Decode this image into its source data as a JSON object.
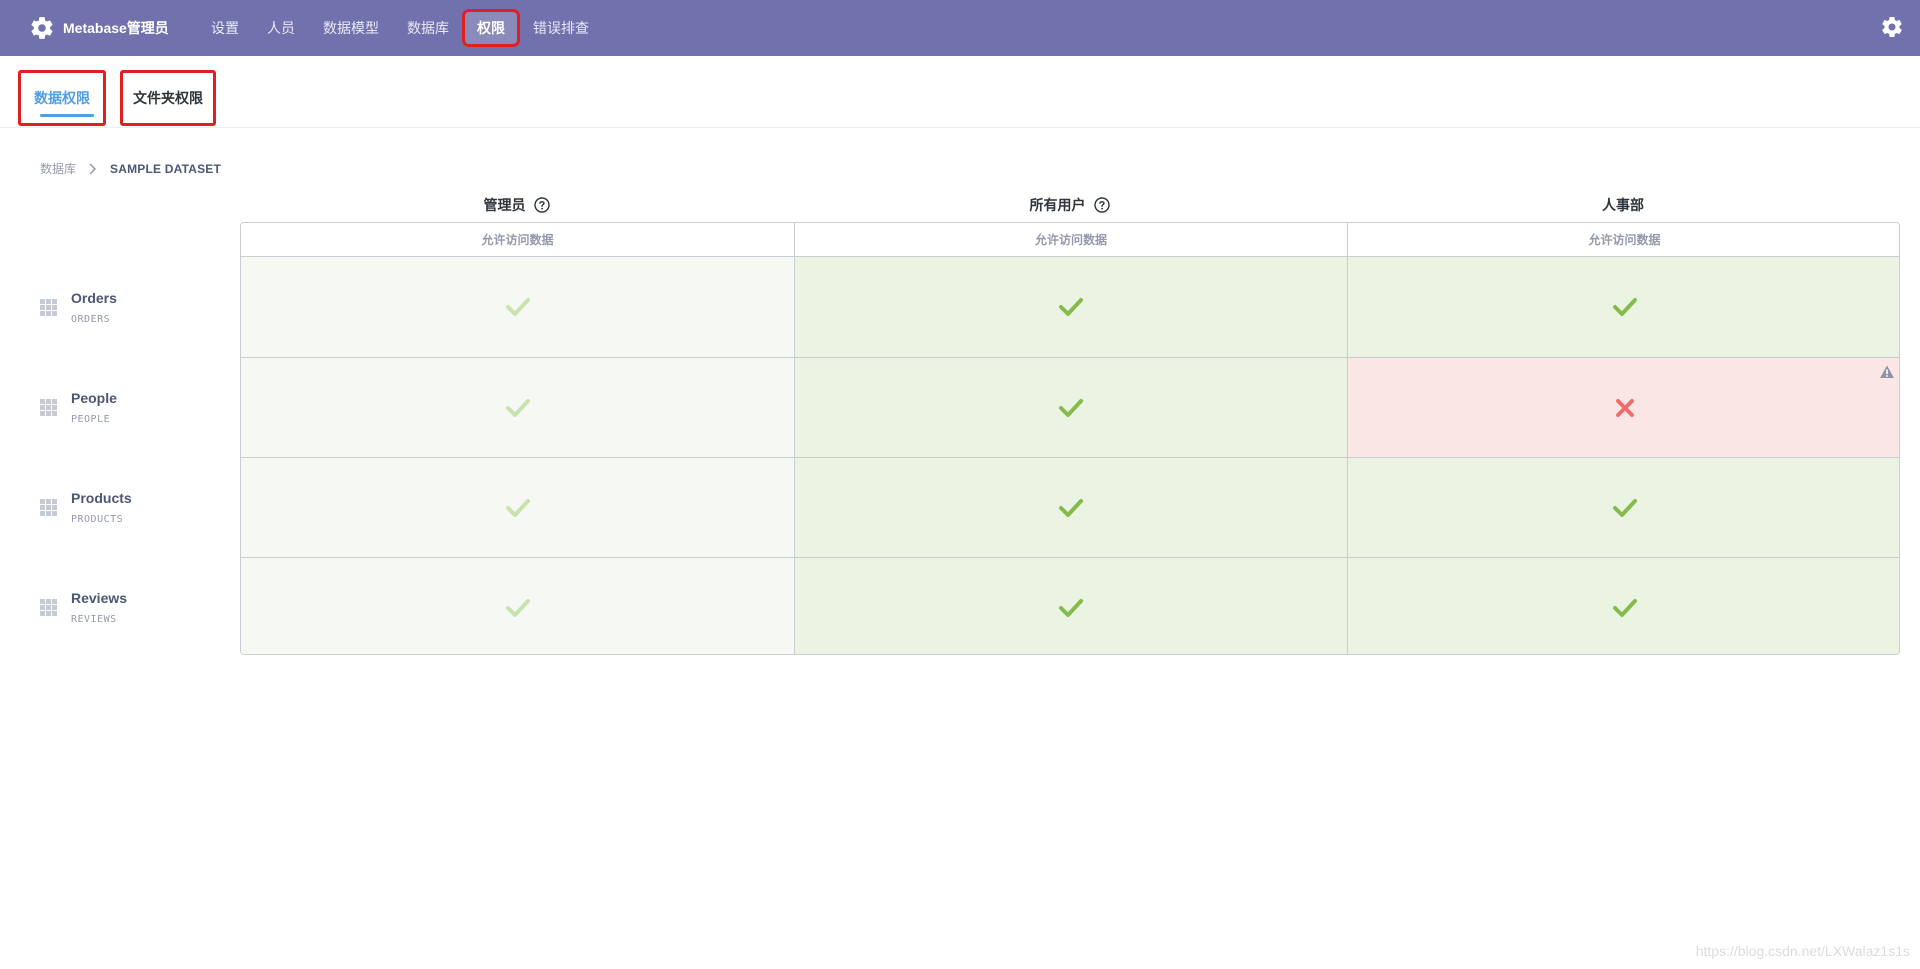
{
  "colors": {
    "nav_bg": "#7172ad",
    "accent": "#509ee3",
    "granted": "#84bb4c",
    "granted_light": "#c8e3ae",
    "denied": "#ed6e6e",
    "highlight_box": "#e02020"
  },
  "nav": {
    "brand": "Metabase管理员",
    "brand_icon": "gear-icon",
    "items": [
      {
        "label": "设置",
        "active": false
      },
      {
        "label": "人员",
        "active": false
      },
      {
        "label": "数据模型",
        "active": false
      },
      {
        "label": "数据库",
        "active": false
      },
      {
        "label": "权限",
        "active": true
      },
      {
        "label": "错误排查",
        "active": false
      }
    ],
    "right_icon": "gear-icon"
  },
  "tabs": [
    {
      "label": "数据权限",
      "active": true
    },
    {
      "label": "文件夹权限",
      "active": false
    }
  ],
  "breadcrumb": {
    "root": "数据库",
    "current": "SAMPLE DATASET"
  },
  "groups": [
    {
      "name": "管理员",
      "help": true,
      "column_header": "允许访问数据"
    },
    {
      "name": "所有用户",
      "help": true,
      "column_header": "允许访问数据"
    },
    {
      "name": "人事部",
      "help": false,
      "column_header": "允许访问数据"
    }
  ],
  "tables": [
    {
      "name": "Orders",
      "schema_name": "ORDERS",
      "access": [
        "granted-locked",
        "granted",
        "granted"
      ],
      "warning": [
        false,
        false,
        false
      ]
    },
    {
      "name": "People",
      "schema_name": "PEOPLE",
      "access": [
        "granted-locked",
        "granted",
        "denied"
      ],
      "warning": [
        false,
        false,
        true
      ]
    },
    {
      "name": "Products",
      "schema_name": "PRODUCTS",
      "access": [
        "granted-locked",
        "granted",
        "granted"
      ],
      "warning": [
        false,
        false,
        false
      ]
    },
    {
      "name": "Reviews",
      "schema_name": "REVIEWS",
      "access": [
        "granted-locked",
        "granted",
        "granted"
      ],
      "warning": [
        false,
        false,
        false
      ]
    }
  ],
  "watermark": "https://blog.csdn.net/LXWalaz1s1s"
}
